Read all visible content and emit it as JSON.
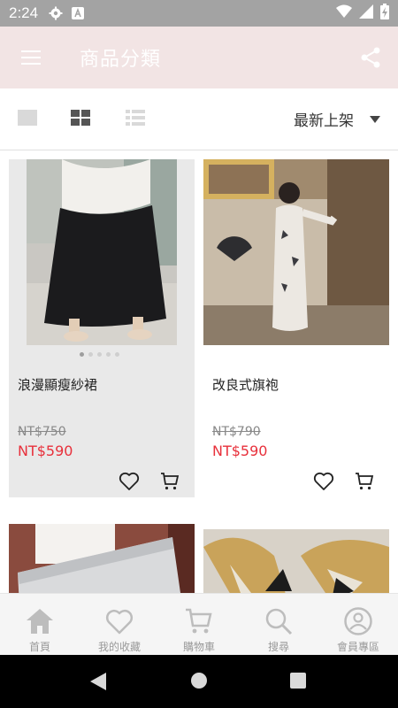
{
  "status_bar": {
    "time": "2:24",
    "icons": [
      "gear-icon",
      "a-badge-icon",
      "wifi-icon",
      "signal-icon",
      "battery-charging-icon"
    ]
  },
  "app_bar": {
    "title": "商品分類",
    "menu_icon": "hamburger-menu-icon",
    "share_icon": "share-icon",
    "background": "#f2e4e4"
  },
  "view_bar": {
    "views": [
      "single-view-icon",
      "grid-view-icon",
      "list-view-icon"
    ],
    "active_view": "grid",
    "sort_label": "最新上架"
  },
  "products": [
    {
      "name": "浪漫顯瘦紗裙",
      "original_price": "NT$750",
      "sale_price": "NT$590",
      "selected": true,
      "image_count": 5,
      "image_index": 0
    },
    {
      "name": "改良式旗袍",
      "original_price": "NT$790",
      "sale_price": "NT$590",
      "selected": false
    },
    {
      "name": "",
      "original_price": "",
      "sale_price": "",
      "selected": false
    },
    {
      "name": "",
      "original_price": "",
      "sale_price": "",
      "selected": false
    }
  ],
  "bottom_nav": {
    "items": [
      {
        "label": "首頁",
        "icon": "home-icon"
      },
      {
        "label": "我的收藏",
        "icon": "heart-icon"
      },
      {
        "label": "購物車",
        "icon": "cart-icon"
      },
      {
        "label": "搜尋",
        "icon": "search-icon"
      },
      {
        "label": "會員專區",
        "icon": "account-icon"
      }
    ]
  },
  "colors": {
    "sale": "#e8303b",
    "nav_icon": "#bdbdbd",
    "selected_card": "#e9e9e9"
  }
}
